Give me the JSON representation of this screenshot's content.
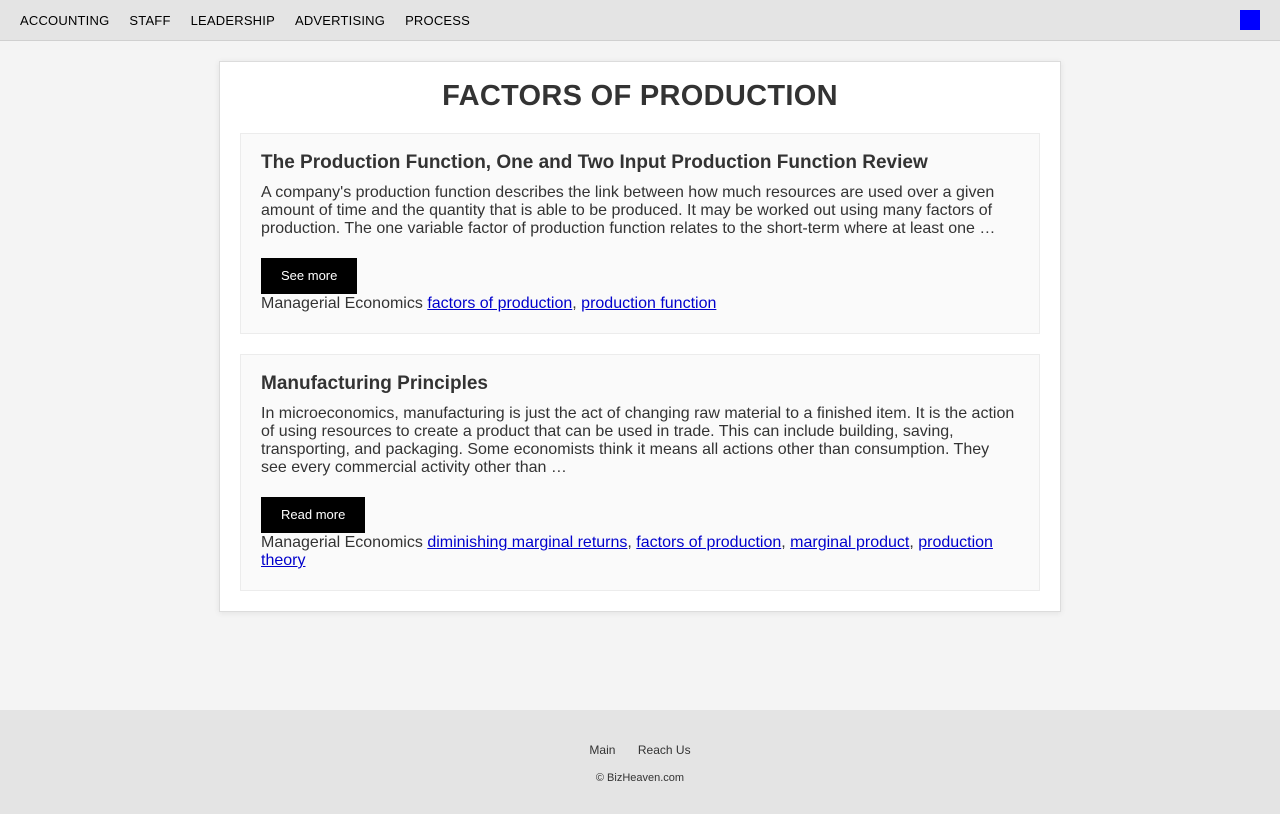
{
  "nav": {
    "items": [
      "ACCOUNTING",
      "STAFF",
      "LEADERSHIP",
      "ADVERTISING",
      "PROCESS"
    ],
    "square_color": "#0000ff"
  },
  "page": {
    "title": "FACTORS OF PRODUCTION"
  },
  "articles": [
    {
      "title": "The Production Function, One and Two Input Production Function Review",
      "excerpt": "A company's production function describes the link between how much resources are used over a given amount of time and the quantity that is able to be produced. It may be worked out using many factors of production. The one variable factor of production function relates to the short-term where at least one …",
      "button": "See more",
      "category": "Managerial Economics",
      "tags": [
        "factors of production",
        "production function"
      ]
    },
    {
      "title": "Manufacturing Principles",
      "excerpt": "In microeconomics, manufacturing is just the act of changing raw material to a finished item. It is the action of using resources to create a product that can be used in trade. This can include building, saving, transporting, and packaging. Some economists think it means all actions other than consumption. They see every commercial activity other than …",
      "button": "Read more",
      "category": "Managerial Economics",
      "tags": [
        "diminishing marginal returns",
        "factors of production",
        "marginal product",
        "production theory"
      ]
    }
  ],
  "footer": {
    "links": [
      "Main",
      "Reach Us"
    ],
    "copyright": "© BizHeaven.com"
  }
}
